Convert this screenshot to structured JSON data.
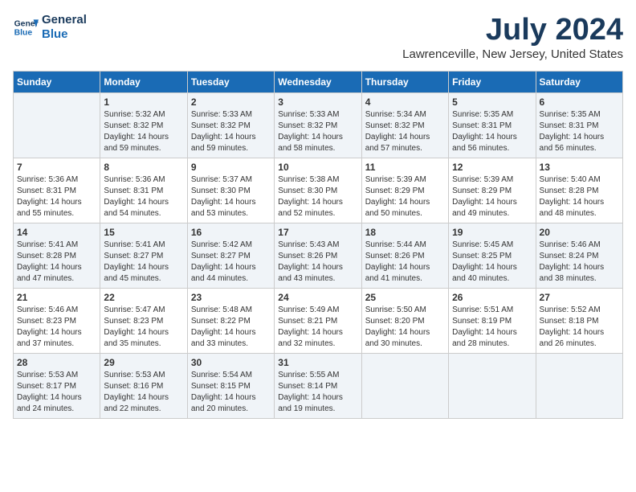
{
  "logo": {
    "line1": "General",
    "line2": "Blue"
  },
  "title": "July 2024",
  "location": "Lawrenceville, New Jersey, United States",
  "days_of_week": [
    "Sunday",
    "Monday",
    "Tuesday",
    "Wednesday",
    "Thursday",
    "Friday",
    "Saturday"
  ],
  "weeks": [
    [
      {
        "day": "",
        "info": ""
      },
      {
        "day": "1",
        "info": "Sunrise: 5:32 AM\nSunset: 8:32 PM\nDaylight: 14 hours\nand 59 minutes."
      },
      {
        "day": "2",
        "info": "Sunrise: 5:33 AM\nSunset: 8:32 PM\nDaylight: 14 hours\nand 59 minutes."
      },
      {
        "day": "3",
        "info": "Sunrise: 5:33 AM\nSunset: 8:32 PM\nDaylight: 14 hours\nand 58 minutes."
      },
      {
        "day": "4",
        "info": "Sunrise: 5:34 AM\nSunset: 8:32 PM\nDaylight: 14 hours\nand 57 minutes."
      },
      {
        "day": "5",
        "info": "Sunrise: 5:35 AM\nSunset: 8:31 PM\nDaylight: 14 hours\nand 56 minutes."
      },
      {
        "day": "6",
        "info": "Sunrise: 5:35 AM\nSunset: 8:31 PM\nDaylight: 14 hours\nand 56 minutes."
      }
    ],
    [
      {
        "day": "7",
        "info": "Sunrise: 5:36 AM\nSunset: 8:31 PM\nDaylight: 14 hours\nand 55 minutes."
      },
      {
        "day": "8",
        "info": "Sunrise: 5:36 AM\nSunset: 8:31 PM\nDaylight: 14 hours\nand 54 minutes."
      },
      {
        "day": "9",
        "info": "Sunrise: 5:37 AM\nSunset: 8:30 PM\nDaylight: 14 hours\nand 53 minutes."
      },
      {
        "day": "10",
        "info": "Sunrise: 5:38 AM\nSunset: 8:30 PM\nDaylight: 14 hours\nand 52 minutes."
      },
      {
        "day": "11",
        "info": "Sunrise: 5:39 AM\nSunset: 8:29 PM\nDaylight: 14 hours\nand 50 minutes."
      },
      {
        "day": "12",
        "info": "Sunrise: 5:39 AM\nSunset: 8:29 PM\nDaylight: 14 hours\nand 49 minutes."
      },
      {
        "day": "13",
        "info": "Sunrise: 5:40 AM\nSunset: 8:28 PM\nDaylight: 14 hours\nand 48 minutes."
      }
    ],
    [
      {
        "day": "14",
        "info": "Sunrise: 5:41 AM\nSunset: 8:28 PM\nDaylight: 14 hours\nand 47 minutes."
      },
      {
        "day": "15",
        "info": "Sunrise: 5:41 AM\nSunset: 8:27 PM\nDaylight: 14 hours\nand 45 minutes."
      },
      {
        "day": "16",
        "info": "Sunrise: 5:42 AM\nSunset: 8:27 PM\nDaylight: 14 hours\nand 44 minutes."
      },
      {
        "day": "17",
        "info": "Sunrise: 5:43 AM\nSunset: 8:26 PM\nDaylight: 14 hours\nand 43 minutes."
      },
      {
        "day": "18",
        "info": "Sunrise: 5:44 AM\nSunset: 8:26 PM\nDaylight: 14 hours\nand 41 minutes."
      },
      {
        "day": "19",
        "info": "Sunrise: 5:45 AM\nSunset: 8:25 PM\nDaylight: 14 hours\nand 40 minutes."
      },
      {
        "day": "20",
        "info": "Sunrise: 5:46 AM\nSunset: 8:24 PM\nDaylight: 14 hours\nand 38 minutes."
      }
    ],
    [
      {
        "day": "21",
        "info": "Sunrise: 5:46 AM\nSunset: 8:23 PM\nDaylight: 14 hours\nand 37 minutes."
      },
      {
        "day": "22",
        "info": "Sunrise: 5:47 AM\nSunset: 8:23 PM\nDaylight: 14 hours\nand 35 minutes."
      },
      {
        "day": "23",
        "info": "Sunrise: 5:48 AM\nSunset: 8:22 PM\nDaylight: 14 hours\nand 33 minutes."
      },
      {
        "day": "24",
        "info": "Sunrise: 5:49 AM\nSunset: 8:21 PM\nDaylight: 14 hours\nand 32 minutes."
      },
      {
        "day": "25",
        "info": "Sunrise: 5:50 AM\nSunset: 8:20 PM\nDaylight: 14 hours\nand 30 minutes."
      },
      {
        "day": "26",
        "info": "Sunrise: 5:51 AM\nSunset: 8:19 PM\nDaylight: 14 hours\nand 28 minutes."
      },
      {
        "day": "27",
        "info": "Sunrise: 5:52 AM\nSunset: 8:18 PM\nDaylight: 14 hours\nand 26 minutes."
      }
    ],
    [
      {
        "day": "28",
        "info": "Sunrise: 5:53 AM\nSunset: 8:17 PM\nDaylight: 14 hours\nand 24 minutes."
      },
      {
        "day": "29",
        "info": "Sunrise: 5:53 AM\nSunset: 8:16 PM\nDaylight: 14 hours\nand 22 minutes."
      },
      {
        "day": "30",
        "info": "Sunrise: 5:54 AM\nSunset: 8:15 PM\nDaylight: 14 hours\nand 20 minutes."
      },
      {
        "day": "31",
        "info": "Sunrise: 5:55 AM\nSunset: 8:14 PM\nDaylight: 14 hours\nand 19 minutes."
      },
      {
        "day": "",
        "info": ""
      },
      {
        "day": "",
        "info": ""
      },
      {
        "day": "",
        "info": ""
      }
    ]
  ]
}
